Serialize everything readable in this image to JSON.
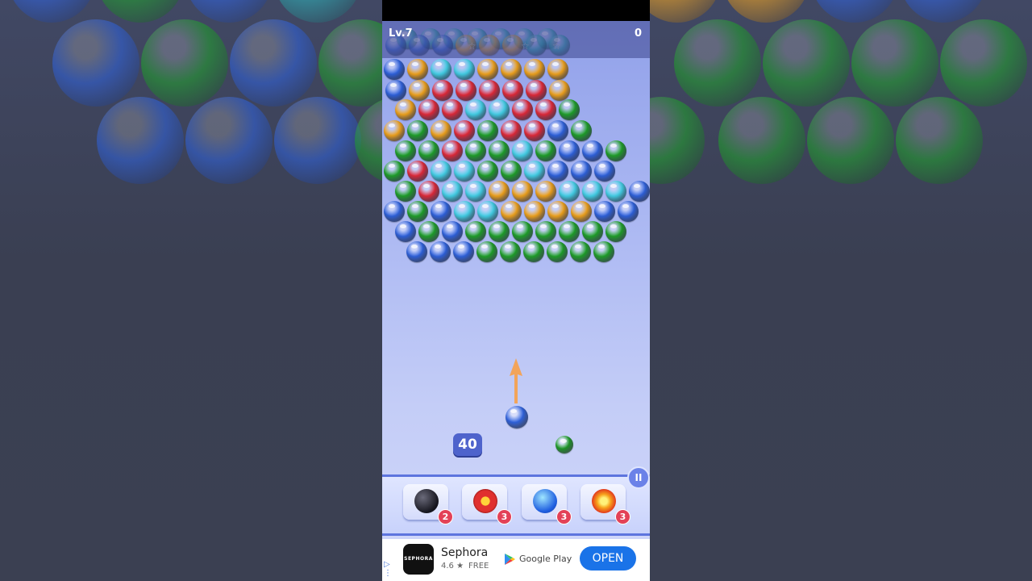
{
  "hud": {
    "level": "Lv.7",
    "score": "0",
    "stars": [
      "☆",
      "☆",
      "☆"
    ]
  },
  "moves_left": "40",
  "pause_icon": "II",
  "colors": {
    "blue": "#2f63e0",
    "green": "#1fa32a",
    "cyan": "#43d3ea",
    "orange": "#f4a51c",
    "red": "#e52a3a",
    "teal": "#2db3b8"
  },
  "shooter": {
    "current_color": "blue",
    "next_color": "green"
  },
  "boosters": [
    {
      "name": "bomb-icon",
      "count": "2"
    },
    {
      "name": "nuke-bomb-icon",
      "count": "3"
    },
    {
      "name": "lightning-ball-icon",
      "count": "3"
    },
    {
      "name": "fire-ball-icon",
      "count": "3"
    }
  ],
  "ad": {
    "title": "Sephora",
    "logo_text": "SEPHORA",
    "rating": "4.6 ★",
    "price": "FREE",
    "store": "Google Play",
    "cta": "OPEN"
  }
}
